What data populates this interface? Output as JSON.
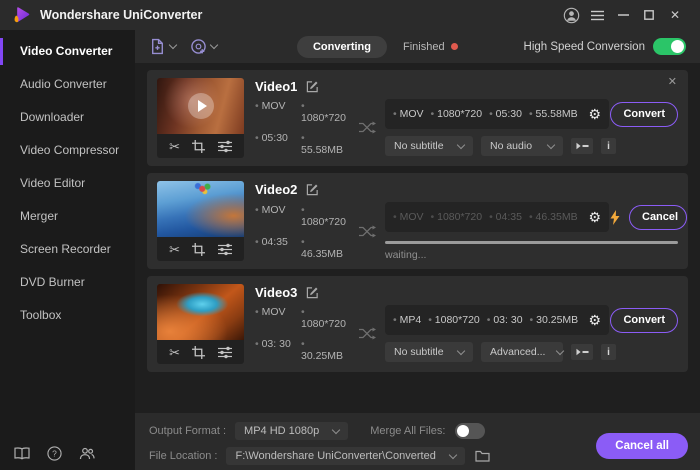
{
  "titlebar": {
    "title": "Wondershare UniConverter"
  },
  "sidebar": {
    "items": [
      {
        "label": "Video Converter",
        "active": true
      },
      {
        "label": "Audio Converter"
      },
      {
        "label": "Downloader"
      },
      {
        "label": "Video Compressor"
      },
      {
        "label": "Video Editor"
      },
      {
        "label": "Merger"
      },
      {
        "label": "Screen Recorder"
      },
      {
        "label": "DVD Burner"
      },
      {
        "label": "Toolbox"
      }
    ]
  },
  "toolbar": {
    "tabs": [
      {
        "label": "Converting",
        "active": true
      },
      {
        "label": "Finished",
        "has_badge": true
      }
    ],
    "high_speed_label": "High Speed Conversion",
    "high_speed_on": true
  },
  "tasks": [
    {
      "title": "Video1",
      "source": {
        "format": "MOV",
        "resolution": "1080*720",
        "duration": "05:30",
        "size": "55.58MB"
      },
      "target": {
        "format": "MOV",
        "resolution": "1080*720",
        "duration": "05:30",
        "size": "55.58MB"
      },
      "action_label": "Convert",
      "subtitle_select": "No subtitle",
      "audio_select": "No audio"
    },
    {
      "title": "Video2",
      "source": {
        "format": "MOV",
        "resolution": "1080*720",
        "duration": "04:35",
        "size": "46.35MB"
      },
      "target": {
        "format": "MOV",
        "resolution": "1080*720",
        "duration": "04:35",
        "size": "46.35MB"
      },
      "action_label": "Cancel",
      "status_text": "waiting...",
      "converting": true
    },
    {
      "title": "Video3",
      "source": {
        "format": "MOV",
        "resolution": "1080*720",
        "duration": "03: 30",
        "size": "30.25MB"
      },
      "target": {
        "format": "MP4",
        "resolution": "1080*720",
        "duration": "03: 30",
        "size": "30.25MB"
      },
      "action_label": "Convert",
      "subtitle_select": "No subtitle",
      "audio_select": "Advanced..."
    }
  ],
  "footer": {
    "output_format_label": "Output Format :",
    "output_format_value": "MP4 HD 1080p",
    "merge_label": "Merge All Files:",
    "merge_on": false,
    "file_location_label": "File Location :",
    "file_location_value": "F:\\Wondershare UniConverter\\Converted",
    "cancel_all_label": "Cancel all"
  },
  "icons": {
    "gear": "⚙",
    "scissors": "✂",
    "close": "✕",
    "info": "i"
  },
  "colors": {
    "accent": "#8b5cf6",
    "toggle_green": "#2bc568",
    "badge_red": "#e05a4e"
  }
}
